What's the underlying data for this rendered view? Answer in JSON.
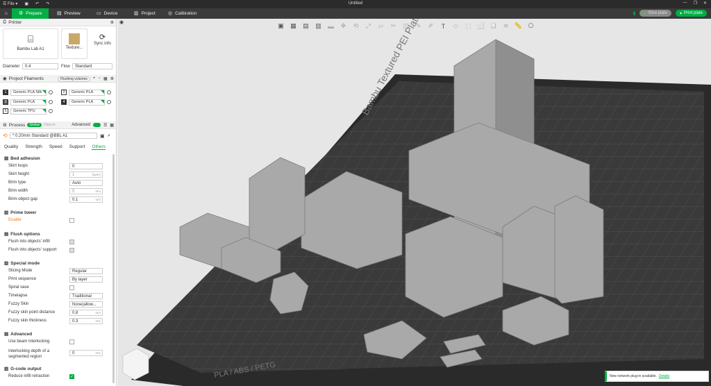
{
  "titlebar": {
    "file": "File",
    "title": "Untitled"
  },
  "menu": {
    "tabs": [
      {
        "label": "Prepare"
      },
      {
        "label": "Preview"
      },
      {
        "label": "Device"
      },
      {
        "label": "Project"
      },
      {
        "label": "Calibration"
      }
    ],
    "slice": "Slice plate",
    "print": "Print plate"
  },
  "printer": {
    "header": "Printer",
    "name": "Bambu Lab A1",
    "plate": "Texture...",
    "sync": "Sync info",
    "diameter_label": "Diameter",
    "diameter": "0.4",
    "flow_label": "Flow",
    "flow": "Standard"
  },
  "filaments": {
    "header": "Project Filaments",
    "flushing": "Flushing volumes",
    "items": [
      {
        "num": "1",
        "name": "Generic PLA Silk",
        "color": "#1a1a1a"
      },
      {
        "num": "2",
        "name": "Generic PLA",
        "color": "#ffffff"
      },
      {
        "num": "3",
        "name": "Generic PLA",
        "color": "#555555"
      },
      {
        "num": "4",
        "name": "Generic PLA",
        "color": "#222222"
      },
      {
        "num": "5",
        "name": "Generic TPU",
        "color": "#ffffff"
      }
    ]
  },
  "process": {
    "header": "Process",
    "global": "Global",
    "objects": "Objects",
    "advanced": "Advanced",
    "preset": "* 0.20mm Standard @BBL A1",
    "tabs": [
      "Quality",
      "Strength",
      "Speed",
      "Support",
      "Others"
    ]
  },
  "groups": {
    "bed": {
      "title": "Bed adhesion",
      "skirt_loops": "Skirt loops",
      "skirt_loops_v": "0",
      "skirt_height": "Skirt height",
      "skirt_height_v": "1",
      "skirt_height_u": "layers",
      "brim_type": "Brim type",
      "brim_type_v": "Auto",
      "brim_width": "Brim width",
      "brim_width_v": "5",
      "brim_gap": "Brim-object gap",
      "brim_gap_v": "0.1",
      "mm": "mm"
    },
    "prime": {
      "title": "Prime tower",
      "enable": "Enable"
    },
    "flush": {
      "title": "Flush options",
      "infill": "Flush into objects' infill",
      "support": "Flush into objects' support"
    },
    "special": {
      "title": "Special mode",
      "slicing": "Slicing Mode",
      "slicing_v": "Regular",
      "sequence": "Print sequence",
      "sequence_v": "By layer",
      "spiral": "Spiral vase",
      "timelapse": "Timelapse",
      "timelapse_v": "Traditional",
      "fuzzy": "Fuzzy Skin",
      "fuzzy_v": "None(allow...",
      "fuzzy_dist": "Fuzzy skin point distance",
      "fuzzy_dist_v": "0.8",
      "fuzzy_thick": "Fuzzy skin thickness",
      "fuzzy_thick_v": "0.3"
    },
    "adv": {
      "title": "Advanced",
      "beam": "Use beam interlocking",
      "depth": "Interlocking depth of a segmented region",
      "depth_v": "0"
    },
    "gcode": {
      "title": "G-code output",
      "reduce": "Reduce infill retraction"
    }
  },
  "plate": {
    "brand": "Bambu Textured PEI Plate",
    "materials": "PLA / ABS / PETG"
  },
  "notif": {
    "text": "New network plug-in available.",
    "link": "Details"
  }
}
